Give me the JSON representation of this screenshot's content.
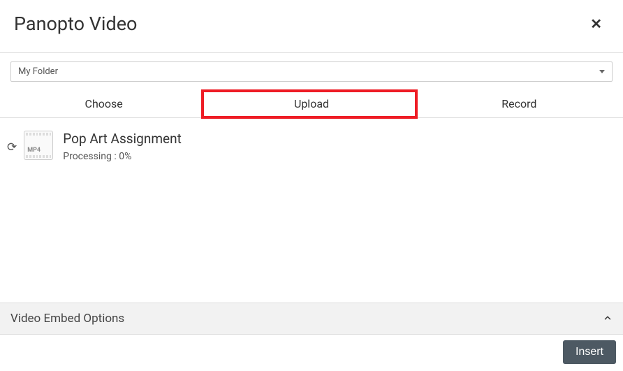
{
  "header": {
    "title": "Panopto Video"
  },
  "folder": {
    "selected": "My Folder"
  },
  "tabs": {
    "choose": "Choose",
    "upload": "Upload",
    "record": "Record"
  },
  "video": {
    "file_type_label": "MP4",
    "title": "Pop Art Assignment",
    "status": "Processing : 0%"
  },
  "embed": {
    "title": "Video Embed Options"
  },
  "footer": {
    "insert_label": "Insert"
  }
}
